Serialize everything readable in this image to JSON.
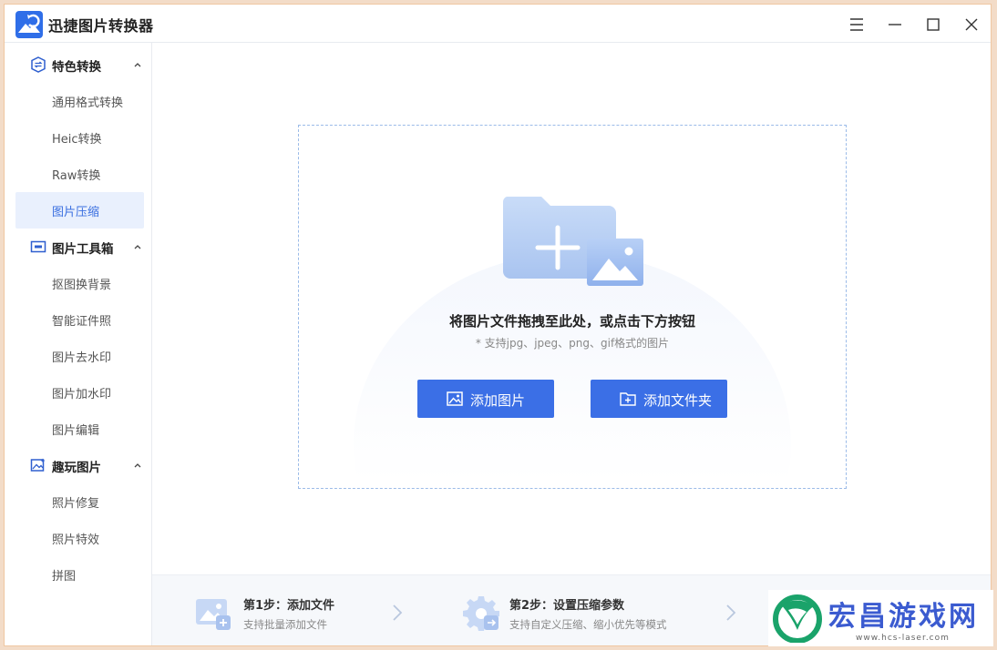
{
  "app": {
    "title": "迅捷图片转换器"
  },
  "sidebar": {
    "groups": [
      {
        "label": "特色转换",
        "items": [
          "通用格式转换",
          "Heic转换",
          "Raw转换",
          "图片压缩"
        ]
      },
      {
        "label": "图片工具箱",
        "items": [
          "抠图换背景",
          "智能证件照",
          "图片去水印",
          "图片加水印",
          "图片编辑"
        ]
      },
      {
        "label": "趣玩图片",
        "items": [
          "照片修复",
          "照片特效",
          "拼图"
        ]
      }
    ],
    "active_item": "图片压缩"
  },
  "dropzone": {
    "title": "将图片文件拖拽至此处，或点击下方按钮",
    "hint": "* 支持jpg、jpeg、png、gif格式的图片",
    "add_image_label": "添加图片",
    "add_folder_label": "添加文件夹"
  },
  "steps": [
    {
      "title": "第1步：添加文件",
      "desc": "支持批量添加文件"
    },
    {
      "title": "第2步：设置压缩参数",
      "desc": "支持自定义压缩、缩小优先等模式"
    }
  ],
  "watermark": {
    "text": "宏昌游戏网",
    "sub": "www.hcs-laser.com"
  },
  "colors": {
    "accent": "#3b6fe6",
    "active_bg": "#e9f0fd",
    "active_text": "#3a6fe0"
  }
}
